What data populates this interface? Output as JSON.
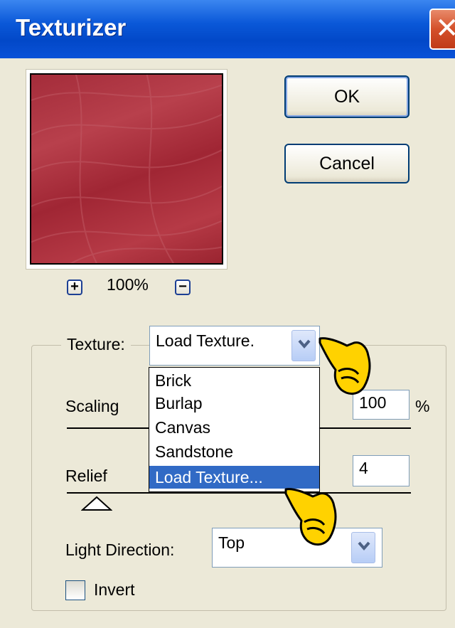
{
  "window": {
    "title": "Texturizer",
    "close_glyph": "✕"
  },
  "preview": {
    "zoom_in": "+",
    "zoom_out": "−",
    "zoom_level": "100%"
  },
  "buttons": {
    "ok": "OK",
    "cancel": "Cancel"
  },
  "texture": {
    "label": "Texture:",
    "selected": "Load Texture.",
    "options": [
      "Brick",
      "Burlap",
      "Canvas",
      "Sandstone",
      "Load Texture..."
    ],
    "highlighted_index": 4
  },
  "scaling": {
    "label": "Scaling",
    "value": "100",
    "unit": "%"
  },
  "relief": {
    "label": "Relief",
    "value": "4",
    "slider_value": 4
  },
  "light_direction": {
    "label": "Light Direction:",
    "value": "Top"
  },
  "invert": {
    "label": "Invert",
    "checked": false
  },
  "colors": {
    "title_bar": "#0a58d8",
    "selection": "#316ac5",
    "texture_red": "#a42c3a",
    "dialog_bg": "#ece9d8"
  },
  "icons": [
    "close-icon",
    "chevron-down-icon",
    "pointing-hand-icon",
    "slider-thumb-icon"
  ]
}
